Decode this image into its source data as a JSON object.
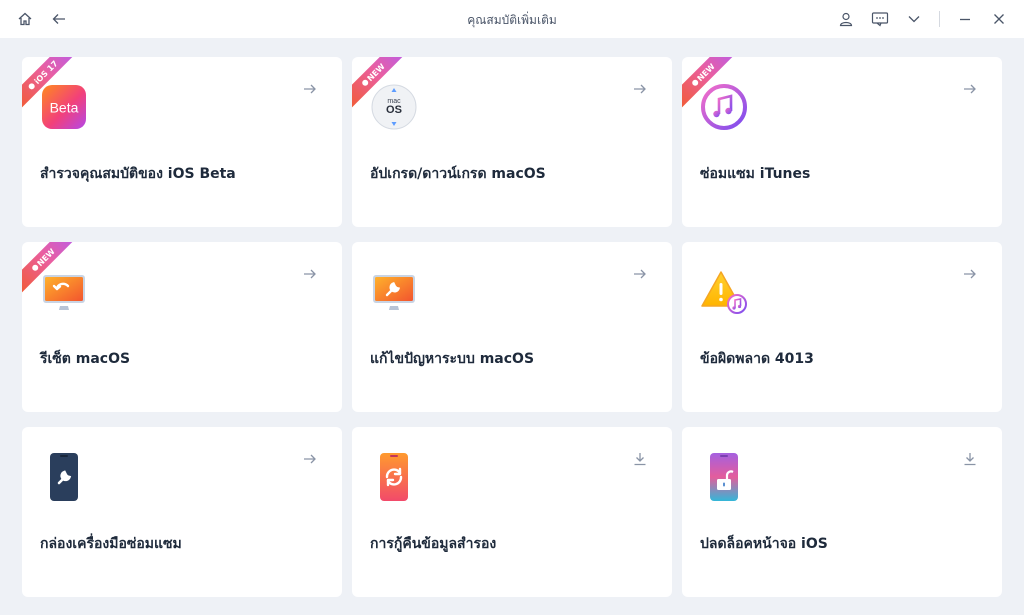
{
  "window": {
    "title": "คุณสมบัติเพิ่มเติม"
  },
  "cards": [
    {
      "label": "สำรวจคุณสมบัติของ iOS Beta",
      "badge": "iOS 17",
      "action": "arrow-right",
      "icon": "ios-beta-icon"
    },
    {
      "label": "อัปเกรด/ดาวน์เกรด macOS",
      "badge": "NEW",
      "action": "arrow-right",
      "icon": "macos-icon"
    },
    {
      "label": "ซ่อมแซม iTunes",
      "badge": "NEW",
      "action": "arrow-right",
      "icon": "itunes-icon"
    },
    {
      "label": "รีเซ็ต macOS",
      "badge": "NEW",
      "action": "arrow-right",
      "icon": "mac-reset-icon"
    },
    {
      "label": "แก้ไขปัญหาระบบ macOS",
      "action": "arrow-right",
      "icon": "mac-repair-icon"
    },
    {
      "label": "ข้อผิดพลาด 4013",
      "action": "arrow-right",
      "icon": "warning-music-icon"
    },
    {
      "label": "กล่องเครื่องมือซ่อมแซม",
      "action": "download",
      "icon": "phone-wrench-icon"
    },
    {
      "label": "การกู้คืนข้อมูลสำรอง",
      "action": "download",
      "icon": "phone-restore-icon"
    },
    {
      "label": "ปลดล็อคหน้าจอ iOS",
      "action": "download",
      "icon": "phone-unlock-icon"
    }
  ],
  "colors": {
    "background": "#eef1f6",
    "card": "#ffffff",
    "ribbon_start": "#f25b2c",
    "ribbon_end": "#b65cf0"
  }
}
